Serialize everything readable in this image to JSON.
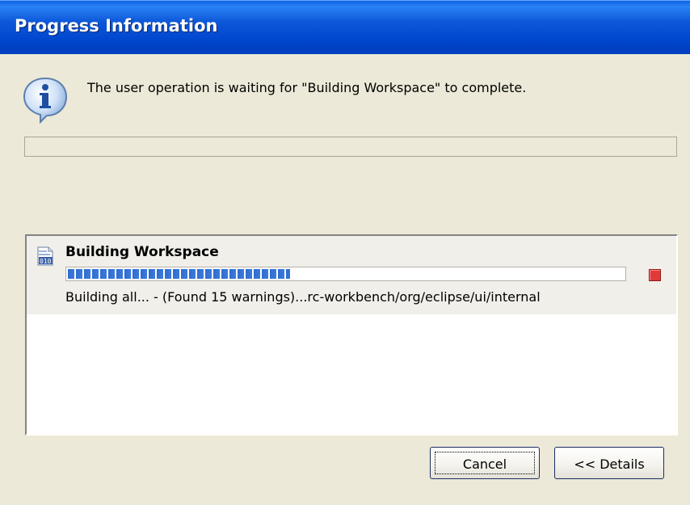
{
  "window": {
    "title": "Progress Information"
  },
  "dialog": {
    "message": "The user operation is waiting for \"Building Workspace\" to complete.",
    "message_icon": "info-icon",
    "overall_progress": 0
  },
  "job": {
    "icon": "binary-file-icon",
    "title": "Building Workspace",
    "progress": 0.4,
    "status": "Building all... - (Found 15 warnings)...rc-workbench/org/eclipse/ui/internal",
    "stop_icon": "stop-icon"
  },
  "buttons": {
    "cancel": "Cancel",
    "details": "<< Details"
  },
  "colors": {
    "titlebar": "#0054e3",
    "dialog_bg": "#ece9d8",
    "progress_fill": "#3b7ade",
    "stop_red": "#e23a3a"
  }
}
